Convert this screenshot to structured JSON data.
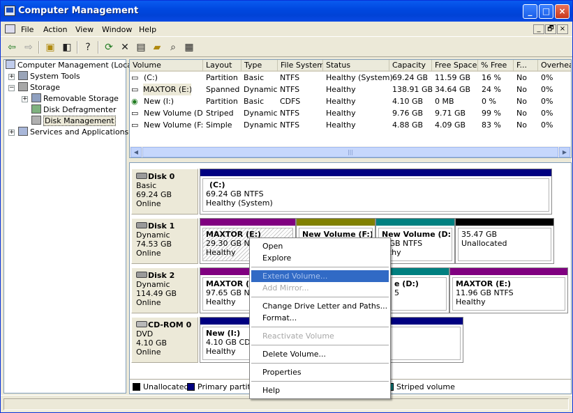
{
  "window": {
    "title": "Computer Management",
    "min": "_",
    "max": "□",
    "close": "×"
  },
  "menu": {
    "items": [
      "File",
      "Action",
      "View",
      "Window",
      "Help"
    ],
    "mdi": [
      "_",
      "🗗",
      "×"
    ]
  },
  "toolbar": {
    "icons": [
      "back-icon",
      "forward-icon",
      "up-folder-icon",
      "show-hide-tree-icon",
      "help-icon",
      "refresh-icon",
      "delete-icon",
      "properties-icon",
      "open-icon",
      "search-icon",
      "disk-icon"
    ]
  },
  "tree": [
    {
      "label": "Computer Management (Local)",
      "icon": "computer-icon"
    },
    {
      "label": "System Tools",
      "icon": "tools-icon"
    },
    {
      "label": "Storage",
      "icon": "storage-icon"
    },
    {
      "label": "Removable Storage",
      "icon": "removable-storage-icon"
    },
    {
      "label": "Disk Defragmenter",
      "icon": "defrag-icon"
    },
    {
      "label": "Disk Management",
      "icon": "disk-management-icon"
    },
    {
      "label": "Services and Applications",
      "icon": "services-icon"
    }
  ],
  "volumes": {
    "columns": [
      "Volume",
      "Layout",
      "Type",
      "File System",
      "Status",
      "Capacity",
      "Free Space",
      "% Free",
      "F...",
      "Overhead"
    ],
    "rows": [
      {
        "volume": "(C:)",
        "layout": "Partition",
        "type": "Basic",
        "fs": "NTFS",
        "status": "Healthy (System)",
        "capacity": "69.24 GB",
        "free": "11.59 GB",
        "pct": "16 %",
        "ft": "No",
        "overhead": "0%"
      },
      {
        "volume": "MAXTOR (E:)",
        "layout": "Spanned",
        "type": "Dynamic",
        "fs": "NTFS",
        "status": "Healthy",
        "capacity": "138.91 GB",
        "free": "34.64 GB",
        "pct": "24 %",
        "ft": "No",
        "overhead": "0%"
      },
      {
        "volume": "New (I:)",
        "layout": "Partition",
        "type": "Basic",
        "fs": "CDFS",
        "status": "Healthy",
        "capacity": "4.10 GB",
        "free": "0 MB",
        "pct": "0 %",
        "ft": "No",
        "overhead": "0%"
      },
      {
        "volume": "New Volume (D:)",
        "layout": "Striped",
        "type": "Dynamic",
        "fs": "NTFS",
        "status": "Healthy",
        "capacity": "9.76 GB",
        "free": "9.71 GB",
        "pct": "99 %",
        "ft": "No",
        "overhead": "0%"
      },
      {
        "volume": "New Volume (F:)",
        "layout": "Simple",
        "type": "Dynamic",
        "fs": "NTFS",
        "status": "Healthy",
        "capacity": "4.88 GB",
        "free": "4.09 GB",
        "pct": "83 %",
        "ft": "No",
        "overhead": "0%"
      }
    ],
    "scroll_left": "◀",
    "scroll_right": "▶",
    "thumb_grip": "|||"
  },
  "disks": [
    {
      "name": "Disk 0",
      "type": "Basic",
      "size": "69.24 GB",
      "state": "Online"
    },
    {
      "name": "Disk 1",
      "type": "Dynamic",
      "size": "74.53 GB",
      "state": "Online"
    },
    {
      "name": "Disk 2",
      "type": "Dynamic",
      "size": "114.49 GB",
      "state": "Online"
    },
    {
      "name": "CD-ROM 0",
      "type": "DVD",
      "size": "4.10 GB",
      "state": "Online"
    }
  ],
  "partitions": {
    "d0c": {
      "title": "(C:)",
      "size": "69.24 GB NTFS",
      "status": "Healthy (System)"
    },
    "d1e": {
      "title": "MAXTOR  (E:)",
      "size": "29.30 GB NTF",
      "status": "Healthy"
    },
    "d1f": {
      "title": "New Volume  (F:)",
      "size": "",
      "status": ""
    },
    "d1d": {
      "title": "New Volume  (D:)",
      "size": "8 GB NTFS",
      "status": "althy"
    },
    "d1u": {
      "title": "",
      "size": "35.47 GB",
      "status": "Unallocated"
    },
    "d2e": {
      "title": "MAXTOR  (E",
      "size": "97.65 GB NTF",
      "status": "Healthy"
    },
    "d2d": {
      "title": "e  (D:)",
      "size": "5",
      "status": ""
    },
    "d2e2": {
      "title": "MAXTOR  (E:)",
      "size": "11.96 GB NTFS",
      "status": "Healthy"
    },
    "cdi": {
      "title": "New  (I:)",
      "size": "4.10 GB CDFS",
      "status": "Healthy"
    }
  },
  "legend": [
    {
      "label": "Unallocated",
      "color": "#000000"
    },
    {
      "label": "Primary partition",
      "color": "#000080"
    },
    {
      "label": "Striped volume",
      "color": "#008080"
    }
  ],
  "colors": {
    "primary": "#000080",
    "spanned": "#800080",
    "simple": "#808000",
    "striped": "#008080",
    "unallocated": "#000000",
    "highlight": "#316ac5"
  },
  "context_menu": {
    "items": [
      "Open",
      "Explore",
      "Extend Volume...",
      "Add Mirror...",
      "Change Drive Letter and Paths...",
      "Format...",
      "Reactivate Volume",
      "Delete Volume...",
      "Properties",
      "Help"
    ]
  }
}
